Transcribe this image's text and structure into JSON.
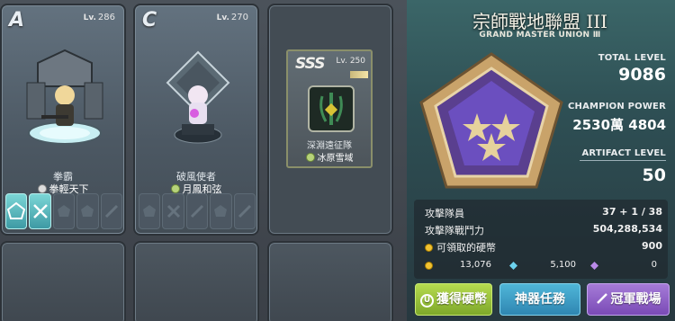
{
  "cards": [
    {
      "grade": "A",
      "lv_prefix": "Lv.",
      "level": "286",
      "class_name": "拳霸",
      "guild": "拳輕天下"
    },
    {
      "grade": "C",
      "lv_prefix": "Lv.",
      "level": "270",
      "class_name": "破風使者",
      "guild": "月鳳和弦"
    }
  ],
  "center_card": {
    "grade": "SSS",
    "lv_prefix": "Lv.",
    "level": "250",
    "class_name": "深淵遠征隊",
    "guild": "冰原雪域"
  },
  "union": {
    "title": "宗師戰地聯盟 III",
    "subtitle": "GRAND MASTER UNION Ⅲ",
    "total_level_label": "TOTAL LEVEL",
    "total_level": "9086",
    "champion_power_label": "CHAMPION POWER",
    "champion_power": "2530萬 4804",
    "artifact_level_label": "ARTIFACT LEVEL",
    "artifact_level": "50"
  },
  "info": {
    "members_label": "攻擊隊員",
    "members_value": "37 + 1 / 38",
    "power_label": "攻擊隊戰鬥力",
    "power_value": "504,288,534",
    "claimable_label": "可領取的硬幣",
    "claimable_value": "900"
  },
  "currencies": {
    "gold": "13,076",
    "blue": "5,100",
    "purple": "0"
  },
  "buttons": {
    "coins": "獲得硬幣",
    "artifact": "神器任務",
    "champion": "冠軍戰場"
  },
  "colors": {
    "green_btn": "#8fbf35",
    "blue_btn": "#3a9cc7",
    "purple_btn": "#8c5cc7"
  }
}
